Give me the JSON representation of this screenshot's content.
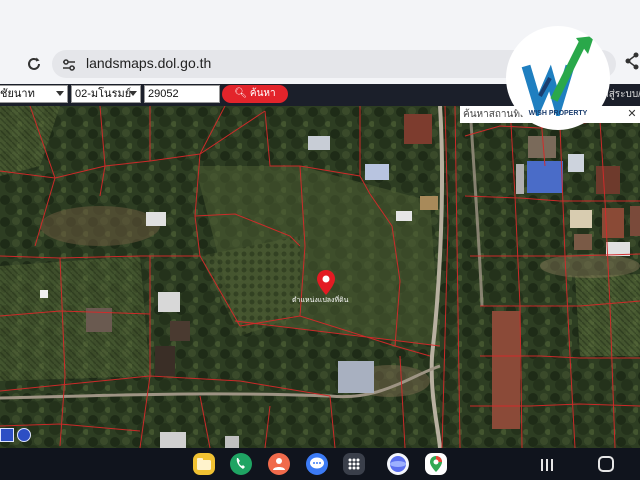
{
  "browser": {
    "url": "landsmaps.dol.go.th"
  },
  "toolbar": {
    "province_value": "ชัยนาท",
    "district_value": "02-มโนรมย์",
    "parcel_number": "29052",
    "search_label": "ค้นหา",
    "login_label": "เข้าสู่ระบบ/ลงท"
  },
  "logo": {
    "caption": "WISH PROPERTY"
  },
  "search_panel": {
    "label": "ค้นหาสถานที่สำคัญ"
  },
  "map": {
    "parcel_label": "ตำแหน่งแปลงที่ดิน",
    "marker_color": "#e31b23",
    "boundary_color": "#d42a2a"
  },
  "taskbar": {
    "apps": [
      "folder-icon",
      "phone-icon",
      "contacts-icon",
      "messages-icon",
      "app-drawer-icon",
      "browser-icon",
      "maps-icon"
    ]
  },
  "colors": {
    "accent": "#e3242b",
    "toolbar_bg": "#1b1f2a",
    "taskbar_bg": "#10141d"
  }
}
